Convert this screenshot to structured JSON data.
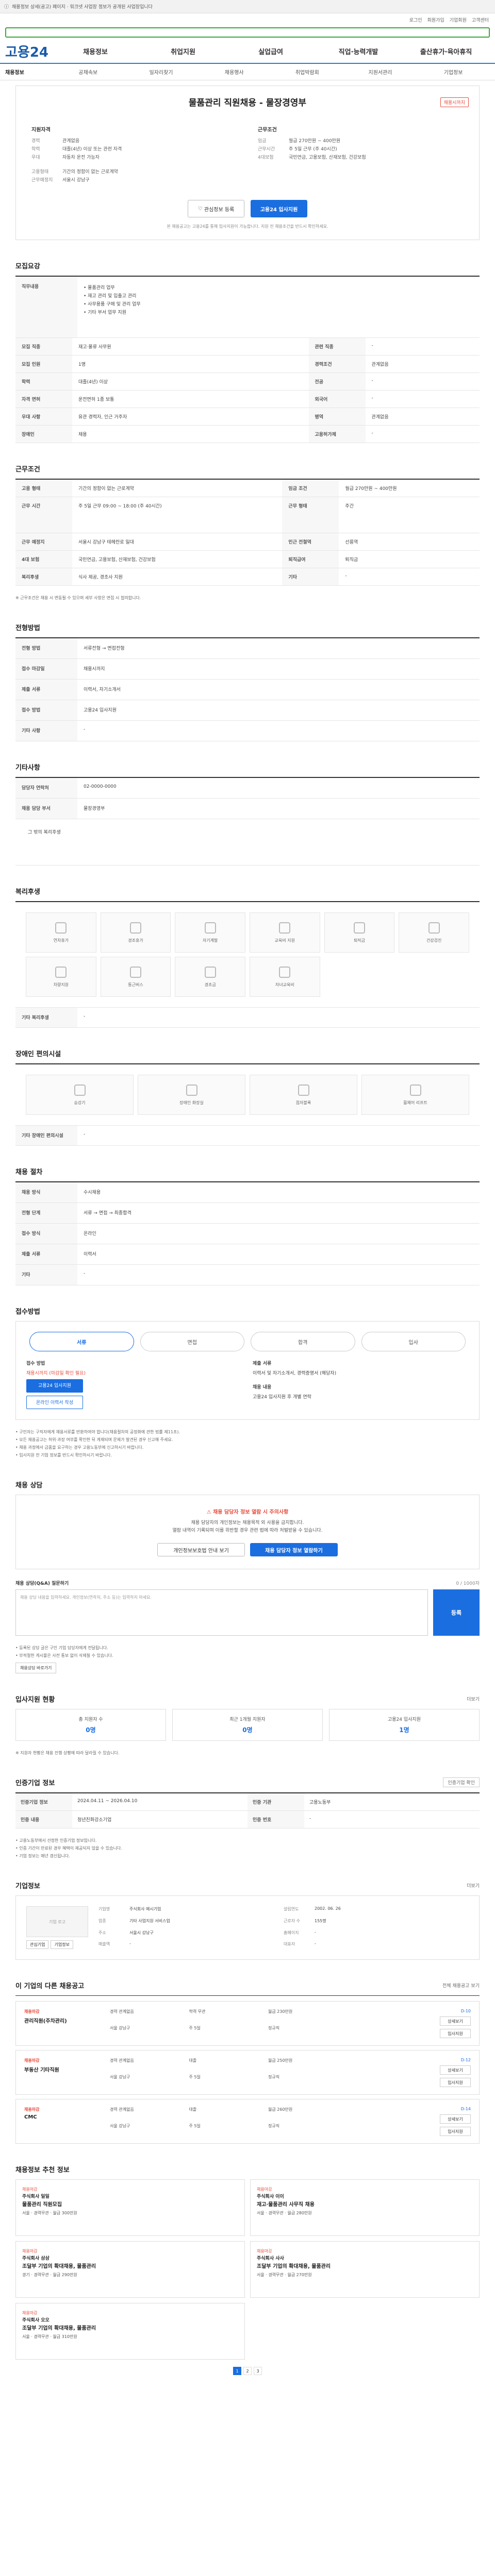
{
  "top": {
    "notice": "채용정보 상세(공고) 페이지 · 워크넷 사업장 정보가 공개된 사업장입니다"
  },
  "gnb": {
    "links": [
      "로그인",
      "회원가입",
      "기업회원",
      "고객센터"
    ]
  },
  "nav": {
    "logo": "고용24",
    "items": [
      "채용정보",
      "취업지원",
      "실업급여",
      "직업·능력개발",
      "출산휴가·육아휴직"
    ],
    "sub": [
      "채용정보",
      "공채속보",
      "일자리찾기",
      "채용행사",
      "취업박람회",
      "지원서관리",
      "기업정보"
    ]
  },
  "job": {
    "title": "물품관리 직원채용 - 물장경영부",
    "badge": "채용시까지",
    "left_head": "지원자격",
    "left_rows": [
      {
        "k": "경력",
        "v": "관계없음"
      },
      {
        "k": "학력",
        "v": "대졸(4년) 이상 또는 관련 자격"
      },
      {
        "k": "우대",
        "v": "자동차 운전 가능자"
      },
      {
        "k": "고용형태",
        "v": "기간의 정함이 없는 근로계약"
      },
      {
        "k": "근무예정지",
        "v": "서울시 강남구"
      }
    ],
    "right_head": "근무조건",
    "right_rows": [
      {
        "k": "임금",
        "v": "월급 270만원 ~ 400만원"
      },
      {
        "k": "근무시간",
        "v": "주 5일 근무 (주 40시간)"
      },
      {
        "k": "4대보험",
        "v": "국민연금, 고용보험, 산재보험, 건강보험"
      }
    ],
    "btn_save": "관심정보 등록",
    "btn_apply": "고용24 입사지원",
    "apply_note": "본 채용공고는 고용24를 통해 입사지원이 가능합니다. 지원 전 채용조건을 반드시 확인하세요."
  },
  "recruit": {
    "title": "모집요강",
    "content_k": "직무내용",
    "content_v": "• 물품관리 업무\n• 재고 관리 및 입출고 관리\n• 사무용품 구매 및 관리 업무\n• 기타 부서 업무 지원",
    "rows": [
      {
        "k": "모집 직종",
        "v": "재고·물류 사무원",
        "k2": "관련 직종",
        "v2": "-"
      },
      {
        "k": "모집 인원",
        "v": "1명",
        "k2": "경력조건",
        "v2": "관계없음"
      },
      {
        "k": "학력",
        "v": "대졸(4년) 이상",
        "k2": "전공",
        "v2": "-"
      },
      {
        "k": "자격 면허",
        "v": "운전면허 1종 보통",
        "k2": "외국어",
        "v2": "-"
      },
      {
        "k": "우대 사항",
        "v": "유관 경력자, 인근 거주자",
        "k2": "병역",
        "v2": "관계없음"
      },
      {
        "k": "장애인",
        "v": "채용",
        "k2": "고용허가제",
        "v2": "-"
      }
    ]
  },
  "conditions": {
    "title": "근무조건",
    "rows": [
      {
        "k": "고용 형태",
        "v": "기간의 정함이 없는 근로계약",
        "k2": "임금 조건",
        "v2": "월급 270만원 ~ 400만원"
      },
      {
        "k": "근무 시간",
        "v": "주 5일 근무 09:00 ~ 18:00 (주 40시간)",
        "k2": "근무 형태",
        "v2": "주간"
      },
      {
        "k": "근무 예정지",
        "v": "서울시 강남구 테헤란로 일대",
        "k2": "인근 전철역",
        "v2": "선릉역"
      },
      {
        "k": "4대 보험",
        "v": "국민연금, 고용보험, 산재보험, 건강보험",
        "k2": "퇴직급여",
        "v2": "퇴직금"
      },
      {
        "k": "복리후생",
        "v": "식사 제공, 경조사 지원",
        "k2": "기타",
        "v2": "-"
      }
    ],
    "note": "※ 근무조건은 채용 시 변동될 수 있으며 세부 사항은 면접 시 협의합니다."
  },
  "process": {
    "title": "전형방법",
    "rows": [
      {
        "k": "전형 방법",
        "v": "서류전형 → 면접전형"
      },
      {
        "k": "접수 마감일",
        "v": "채용시까지"
      },
      {
        "k": "제출 서류",
        "v": "이력서, 자기소개서"
      },
      {
        "k": "접수 방법",
        "v": "고용24 입사지원"
      },
      {
        "k": "기타 사항",
        "v": "-"
      }
    ]
  },
  "contact": {
    "title": "기타사항",
    "rows": [
      {
        "k": "담당자 연락처",
        "v": "02-0000-0000"
      },
      {
        "k": "채용 담당 부서",
        "v": "물장경영부"
      }
    ],
    "extra": "그 밖의 복리후생"
  },
  "welfare": {
    "title": "복리후생",
    "items": [
      "연차휴가",
      "경조휴가",
      "자기계발",
      "교육비 지원",
      "퇴직금",
      "건강검진",
      "차량지원",
      "통근버스",
      "경조금",
      "자녀교육비"
    ],
    "etc_k": "기타 복리후생",
    "etc_v": "-"
  },
  "disability": {
    "title": "장애인 편의시설",
    "items": [
      "승강기",
      "장애인 화장실",
      "점자블록",
      "휠체어 리프트"
    ],
    "etc_k": "기타 장애인 편의시설",
    "etc_v": "-"
  },
  "hiring_proc": {
    "title": "채용 절차",
    "rows": [
      {
        "k": "채용 방식",
        "v": "수시채용"
      },
      {
        "k": "전형 단계",
        "v": "서류 → 면접 → 최종합격"
      },
      {
        "k": "접수 방식",
        "v": "온라인"
      },
      {
        "k": "제출 서류",
        "v": "이력서"
      },
      {
        "k": "기타",
        "v": "-"
      }
    ]
  },
  "apply_guide": {
    "title": "접수방법",
    "steps": [
      "서류",
      "면접",
      "합격",
      "입사"
    ],
    "left_hd": "접수 방법",
    "left_v": "채용시까지 (마감일 확인 필요)",
    "btn1": "고용24 입사지원",
    "btn2": "온라인 이력서 작성",
    "right_hd": "제출 서류",
    "right_v": "이력서 및 자기소개서, 경력증명서 (해당자)",
    "right_hd2": "채용 내용",
    "right_v2": "고용24 입사지원 후 개별 연락",
    "notes": [
      "• 구인자는 구직자에게 채용서류를 반환하여야 합니다(채용절차의 공정화에 관한 법률 제11조).",
      "• 모든 채용공고는 허위·과장 여부를 확인한 뒤 게재되며 문제가 발견된 경우 신고해 주세요.",
      "• 채용 과정에서 금품을 요구하는 경우 고용노동부에 신고하시기 바랍니다.",
      "• 입사지원 전 기업 정보를 반드시 확인하시기 바랍니다."
    ]
  },
  "consult": {
    "title": "채용 상담",
    "warn": "채용 담당자 정보 열람 시 주의사항",
    "desc": "채용 담당자의 개인정보는 채용목적 외 사용을 금지합니다.\n열람 내역이 기록되며 이를 위반할 경우 관련 법에 따라 처벌받을 수 있습니다.",
    "btn1": "개인정보보호법 안내 보기",
    "btn2": "채용 담당자 정보 열람하기",
    "qna_head": "채용 상담(Q&A) 질문하기",
    "qna_count": "0 / 1000자",
    "qna_placeholder": "채용 상담 내용을 입력하세요. 개인정보(연락처, 주소 등)는 입력하지 마세요.",
    "qna_send": "등록",
    "notes": [
      "• 등록된 상담 글은 구인 기업 담당자에게 전달됩니다.",
      "• 부적절한 게시물은 사전 통보 없이 삭제될 수 있습니다."
    ],
    "link": "채용상담 바로가기"
  },
  "status": {
    "title": "입사지원 현황",
    "more": "더보기",
    "items": [
      {
        "label": "총 지원자 수",
        "value": "0명"
      },
      {
        "label": "최근 1개월 지원자",
        "value": "0명"
      },
      {
        "label": "고용24 입사지원",
        "value": "1명"
      }
    ],
    "note": "※ 지원자 현황은 채용 진행 상황에 따라 달라질 수 있습니다."
  },
  "info": {
    "title": "인증기업 정보",
    "btn": "인증기업 확인",
    "rows": [
      {
        "k": "인증기업 정보",
        "v": "2024.04.11 ~ 2026.04.10",
        "k2": "인증 기관",
        "v2": "고용노동부"
      },
      {
        "k": "인증 내용",
        "v": "청년친화강소기업",
        "k2": "인증 번호",
        "v2": "-"
      }
    ],
    "notes": [
      "• 고용노동부에서 선정한 인증기업 정보입니다.",
      "• 인증 기간이 만료된 경우 혜택이 제공되지 않을 수 있습니다.",
      "• 기업 정보는 매년 갱신됩니다."
    ]
  },
  "corp": {
    "title": "기업정보",
    "more": "더보기",
    "logo_alt": "기업 로고",
    "btn1": "관심기업",
    "btn2": "기업정보",
    "fields": [
      {
        "k": "기업명",
        "v": "주식회사 예시기업"
      },
      {
        "k": "설립연도",
        "v": "2002. 06. 26"
      },
      {
        "k": "업종",
        "v": "기타 사업지원 서비스업"
      },
      {
        "k": "근로자 수",
        "v": "155명"
      },
      {
        "k": "주소",
        "v": "서울시 강남구"
      },
      {
        "k": "홈페이지",
        "v": "-"
      },
      {
        "k": "매출액",
        "v": "-"
      },
      {
        "k": "대표자",
        "v": "-"
      }
    ]
  },
  "other_jobs": {
    "title": "이 기업의 다른 채용공고",
    "more": "전체 채용공고 보기",
    "items": [
      {
        "co": "채용마감",
        "title": "관리직원(주차관리)",
        "a": "경력 관계없음",
        "b": "학력 무관",
        "c": "월급 230만원",
        "d": "서울 강남구",
        "e": "주 5일",
        "f": "정규직",
        "dday": "D-10"
      },
      {
        "co": "채용마감",
        "title": "부동산 기타직원",
        "a": "경력 관계없음",
        "b": "대졸",
        "c": "월급 250만원",
        "d": "서울 강남구",
        "e": "주 5일",
        "f": "정규직",
        "dday": "D-12"
      },
      {
        "co": "채용마감",
        "title": "CMC",
        "a": "경력 관계없음",
        "b": "대졸",
        "c": "월급 260만원",
        "d": "서울 강남구",
        "e": "주 5일",
        "f": "정규직",
        "dday": "D-14"
      }
    ],
    "btn_a": "상세보기",
    "btn_b": "입사지원"
  },
  "recommend": {
    "title": "채용정보 추천 정보",
    "items": [
      {
        "tag": "채용마감",
        "co": "주식회사 일일",
        "title": "물품관리 직원모집",
        "sub": "서울 · 경력무관 · 월급 300만원"
      },
      {
        "tag": "채용마감",
        "co": "주식회사 이이",
        "title": "재고·물품관리 사무직 채용",
        "sub": "서울 · 경력무관 · 월급 280만원"
      },
      {
        "tag": "채용마감",
        "co": "주식회사 삼삼",
        "title": "조달부 기업의 확대채용, 물품관리",
        "sub": "경기 · 경력무관 · 월급 290만원"
      },
      {
        "tag": "채용마감",
        "co": "주식회사 사사",
        "title": "조달부 기업의 확대채용, 물품관리",
        "sub": "서울 · 경력무관 · 월급 270만원"
      },
      {
        "tag": "채용마감",
        "co": "주식회사 오오",
        "title": "조달부 기업의 확대채용, 물품관리",
        "sub": "서울 · 경력무관 · 월급 310만원"
      }
    ],
    "pages": [
      "1",
      "2",
      "3"
    ]
  }
}
